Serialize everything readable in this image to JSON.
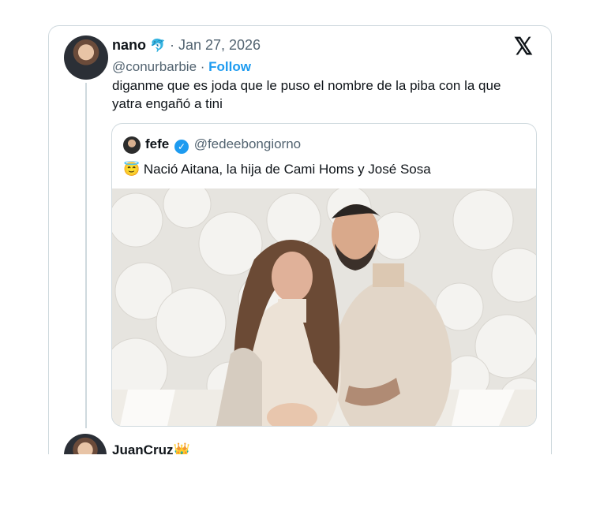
{
  "tweet": {
    "author_name": "nano",
    "author_emoji": "🐬",
    "date_sep": " · ",
    "date": "Jan 27, 2026",
    "handle": "@conurbarbie",
    "follow_sep": " · ",
    "follow_label": "Follow",
    "text": "diganme que es joda que le puso el nombre de la piba con la que yatra engañó a tini",
    "brand_icon": "x-logo-icon"
  },
  "quoted": {
    "author_name": "fefe",
    "handle": "@fedeebongiorno",
    "emoji": "😇",
    "text": "Nació Aitana, la hija de Cami Homs y José Sosa",
    "verified_icon": "verified-badge-icon"
  },
  "reply": {
    "author_name": "JuanCruz",
    "emoji": "👑"
  },
  "colors": {
    "link": "#1d9bf0",
    "secondary_text": "#536471",
    "border": "#cfd9de",
    "text": "#0f1419"
  }
}
